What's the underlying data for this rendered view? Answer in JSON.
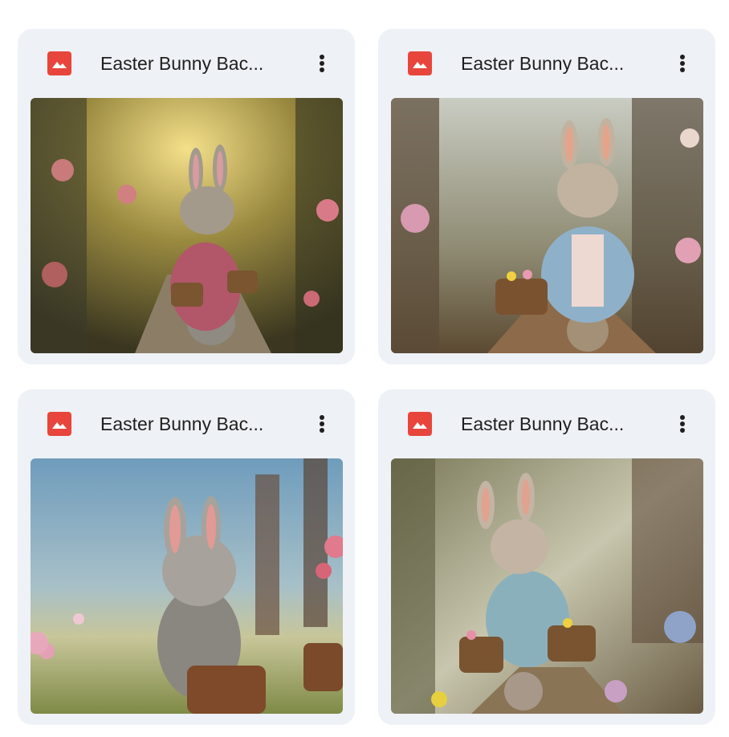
{
  "files": [
    {
      "title": "Easter Bunny Bac...",
      "file_type_icon": "image-file-icon",
      "menu_icon": "more-vert-icon",
      "thumbnail": "easter-bunny-forest-path"
    },
    {
      "title": "Easter Bunny Bac...",
      "file_type_icon": "image-file-icon",
      "menu_icon": "more-vert-icon",
      "thumbnail": "easter-bunny-blue-jacket"
    },
    {
      "title": "Easter Bunny Bac...",
      "file_type_icon": "image-file-icon",
      "menu_icon": "more-vert-icon",
      "thumbnail": "easter-bunny-meadow"
    },
    {
      "title": "Easter Bunny Bac...",
      "file_type_icon": "image-file-icon",
      "menu_icon": "more-vert-icon",
      "thumbnail": "easter-bunny-two-baskets"
    }
  ],
  "colors": {
    "card_background": "#eef1f5",
    "image_icon": "#e8453c",
    "title_text": "#1f1f1f"
  }
}
